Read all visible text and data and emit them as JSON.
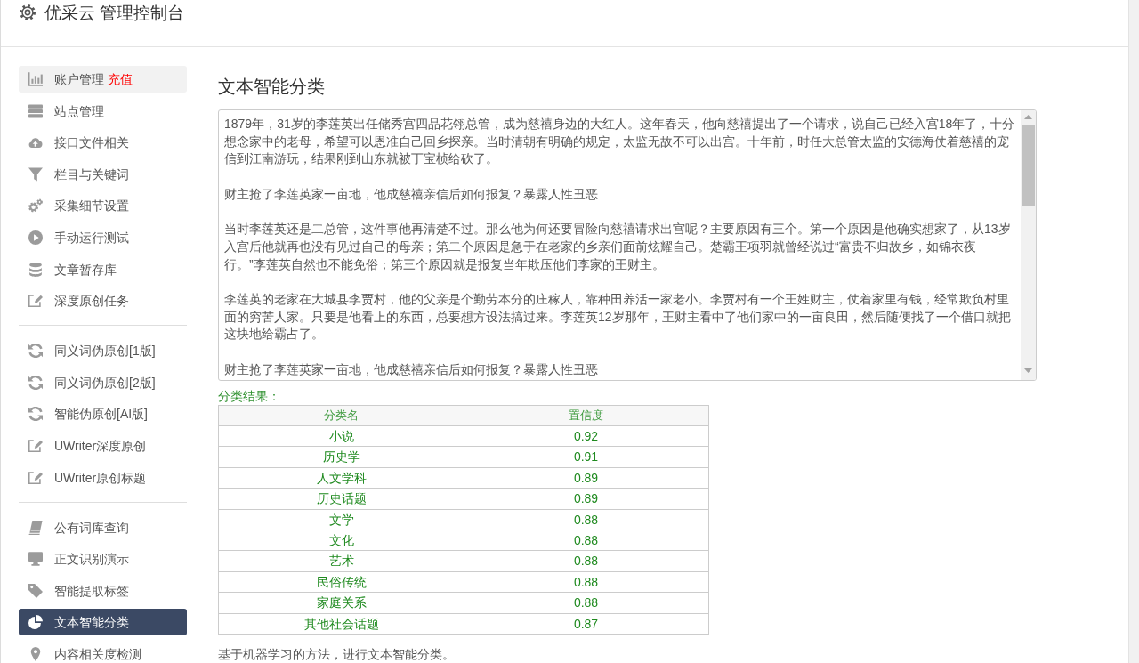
{
  "header": {
    "title": "优采云 管理控制台"
  },
  "sidebar": {
    "groups": [
      {
        "items": [
          {
            "label": "账户管理",
            "badge": "充值",
            "selected": false,
            "highlighted": true
          },
          {
            "label": "站点管理",
            "selected": false,
            "highlighted": false
          },
          {
            "label": "接口文件相关",
            "selected": false,
            "highlighted": false
          },
          {
            "label": "栏目与关键词",
            "selected": false,
            "highlighted": false
          },
          {
            "label": "采集细节设置",
            "selected": false,
            "highlighted": false
          },
          {
            "label": "手动运行测试",
            "selected": false,
            "highlighted": false
          },
          {
            "label": "文章暂存库",
            "selected": false,
            "highlighted": false
          },
          {
            "label": "深度原创任务",
            "selected": false,
            "highlighted": false
          }
        ]
      },
      {
        "items": [
          {
            "label": "同义词伪原创[1版]",
            "selected": false,
            "highlighted": false
          },
          {
            "label": "同义词伪原创[2版]",
            "selected": false,
            "highlighted": false
          },
          {
            "label": "智能伪原创[AI版]",
            "selected": false,
            "highlighted": false
          },
          {
            "label": "UWriter深度原创",
            "selected": false,
            "highlighted": false
          },
          {
            "label": "UWriter原创标题",
            "selected": false,
            "highlighted": false
          }
        ]
      },
      {
        "items": [
          {
            "label": "公有词库查询",
            "selected": false,
            "highlighted": false
          },
          {
            "label": "正文识别演示",
            "selected": false,
            "highlighted": false
          },
          {
            "label": "智能提取标签",
            "selected": false,
            "highlighted": false
          },
          {
            "label": "文本智能分类",
            "selected": true,
            "highlighted": false
          },
          {
            "label": "内容相关度检测",
            "selected": false,
            "highlighted": false
          }
        ]
      }
    ]
  },
  "main": {
    "title": "文本智能分类",
    "article": {
      "paragraphs": [
        "1879年，31岁的李莲英出任储秀宫四品花翎总管，成为慈禧身边的大红人。这年春天，他向慈禧提出了一个请求，说自己已经入宫18年了，十分想念家中的老母，希望可以恩准自己回乡探亲。当时清朝有明确的规定，太监无故不可以出宫。十年前，时任大总管太监的安德海仗着慈禧的宠信到江南游玩，结果刚到山东就被丁宝桢给砍了。",
        "财主抢了李莲英家一亩地，他成慈禧亲信后如何报复？暴露人性丑恶",
        "当时李莲英还是二总管，这件事他再清楚不过。那么他为何还要冒险向慈禧请求出宫呢？主要原因有三个。第一个原因是他确实想家了，从13岁入宫后他就再也没有见过自己的母亲；第二个原因是急于在老家的乡亲们面前炫耀自己。楚霸王项羽就曾经说过“富贵不归故乡，如锦衣夜行。”李莲英自然也不能免俗；第三个原因就是报复当年欺压他们李家的王财主。",
        "李莲英的老家在大城县李贾村，他的父亲是个勤劳本分的庄稼人，靠种田养活一家老小。李贾村有一个王姓财主，仗着家里有钱，经常欺负村里面的穷苦人家。只要是他看上的东西，总要想方设法搞过来。李莲英12岁那年，王财主看中了他们家中的一亩良田，然后随便找了一个借口就把这块地给霸占了。",
        "财主抢了李莲英家一亩地，他成慈禧亲信后如何报复？暴露人性丑恶"
      ]
    },
    "result_label": "分类结果：",
    "table": {
      "columns": [
        "分类名",
        "置信度"
      ],
      "rows": [
        [
          "小说",
          "0.92"
        ],
        [
          "历史学",
          "0.91"
        ],
        [
          "人文学科",
          "0.89"
        ],
        [
          "历史话题",
          "0.89"
        ],
        [
          "文学",
          "0.88"
        ],
        [
          "文化",
          "0.88"
        ],
        [
          "艺术",
          "0.88"
        ],
        [
          "民俗传统",
          "0.88"
        ],
        [
          "家庭关系",
          "0.88"
        ],
        [
          "其他社会话题",
          "0.87"
        ]
      ]
    },
    "footer_note": "基于机器学习的方法，进行文本智能分类。"
  }
}
